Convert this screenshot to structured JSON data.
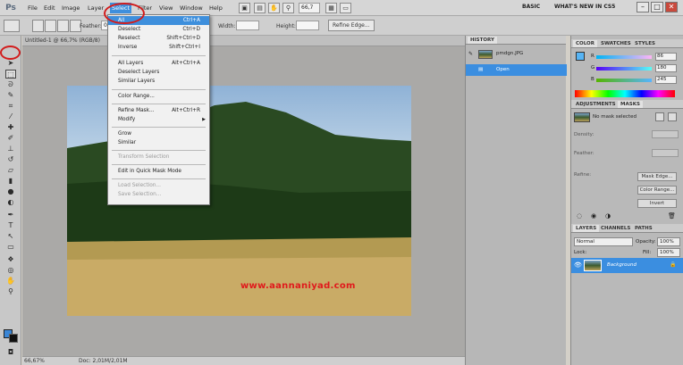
{
  "menubar": {
    "logo": "Ps",
    "items": [
      "File",
      "Edit",
      "Image",
      "Layer",
      "Select",
      "Filter",
      "View",
      "Window",
      "Help"
    ],
    "zoom": "66,7",
    "workspaces": [
      "BASIC",
      "WHAT'S NEW IN CS5"
    ]
  },
  "options": {
    "feather_label": "Feather:",
    "feather_value": "0",
    "width_label": "Width:",
    "height_label": "Height:",
    "refine_edge": "Refine Edge..."
  },
  "document": {
    "tab_title": "Untitled-1 @ 66,7% (RGB/8)",
    "status_zoom": "66,67%",
    "status_doc": "Doc: 2,01M/2,01M",
    "watermark": "www.aannaniyad.com"
  },
  "select_menu": {
    "items": [
      {
        "label": "All",
        "shortcut": "Ctrl+A",
        "state": "active"
      },
      {
        "label": "Deselect",
        "shortcut": "Ctrl+D",
        "state": "normal"
      },
      {
        "label": "Reselect",
        "shortcut": "Shift+Ctrl+D",
        "state": "normal"
      },
      {
        "label": "Inverse",
        "shortcut": "Shift+Ctrl+I",
        "state": "normal"
      },
      {
        "label": "All Layers",
        "shortcut": "Alt+Ctrl+A",
        "state": "normal"
      },
      {
        "label": "Deselect Layers",
        "shortcut": "",
        "state": "normal"
      },
      {
        "label": "Similar Layers",
        "shortcut": "",
        "state": "normal"
      },
      {
        "label": "Color Range...",
        "shortcut": "",
        "state": "normal"
      },
      {
        "label": "Refine Mask...",
        "shortcut": "Alt+Ctrl+R",
        "state": "normal"
      },
      {
        "label": "Modify",
        "shortcut": "",
        "state": "normal"
      },
      {
        "label": "Grow",
        "shortcut": "",
        "state": "normal"
      },
      {
        "label": "Similar",
        "shortcut": "",
        "state": "normal"
      },
      {
        "label": "Transform Selection",
        "shortcut": "",
        "state": "disabled"
      },
      {
        "label": "Edit in Quick Mask Mode",
        "shortcut": "",
        "state": "normal"
      },
      {
        "label": "Load Selection...",
        "shortcut": "",
        "state": "disabled"
      },
      {
        "label": "Save Selection...",
        "shortcut": "",
        "state": "disabled"
      }
    ]
  },
  "history": {
    "tab": "HISTORY",
    "snapshot": "pmdgn.JPG",
    "step": "Open"
  },
  "color": {
    "tabs": [
      "COLOR",
      "SWATCHES",
      "STYLES"
    ],
    "r_label": "R",
    "r_value": "86",
    "g_label": "G",
    "g_value": "180",
    "b_label": "B",
    "b_value": "245",
    "fg_color": "#56b4f5"
  },
  "masks": {
    "tabs": [
      "ADJUSTMENTS",
      "MASKS"
    ],
    "status": "No mask selected",
    "density_label": "Density:",
    "feather_label": "Feather:",
    "refine_label": "Refine:",
    "mask_edge": "Mask Edge...",
    "color_range": "Color Range...",
    "invert": "Invert"
  },
  "layers": {
    "tabs": [
      "LAYERS",
      "CHANNELS",
      "PATHS"
    ],
    "blend_mode": "Normal",
    "opacity_label": "Opacity:",
    "opacity_value": "100%",
    "lock_label": "Lock:",
    "fill_label": "Fill:",
    "fill_value": "100%",
    "layer_name": "Background"
  }
}
